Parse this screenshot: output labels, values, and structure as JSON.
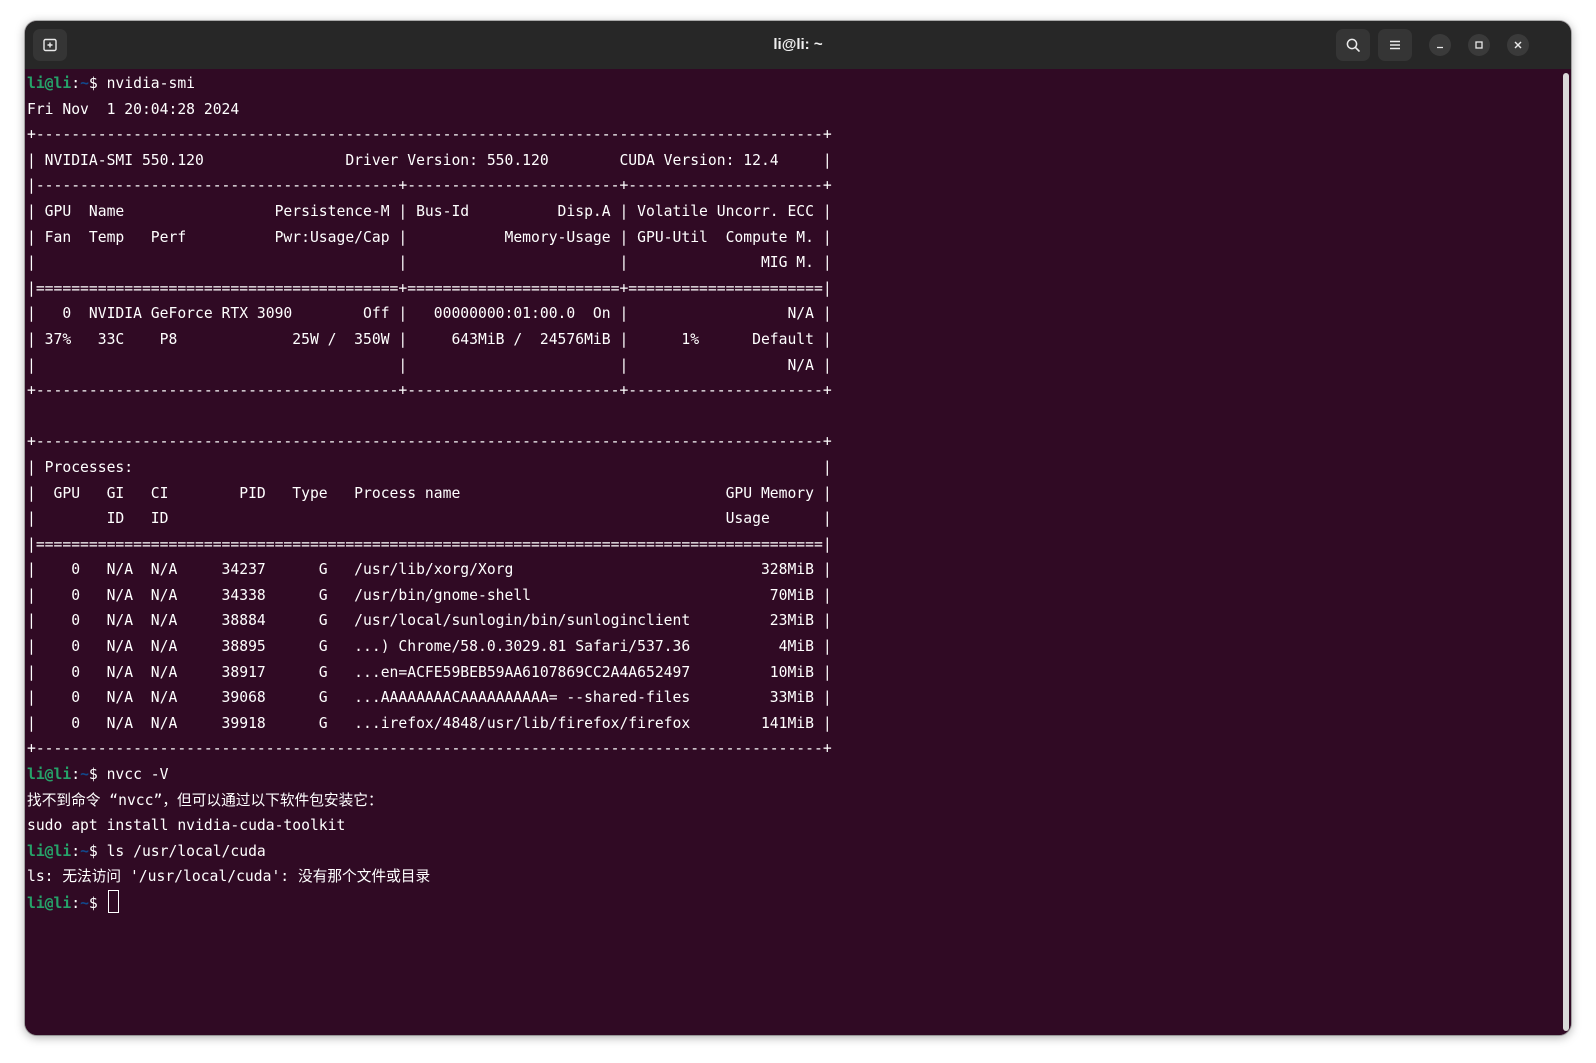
{
  "window": {
    "title": "li@li: ~"
  },
  "colors": {
    "terminal_bg": "#300a24",
    "titlebar_bg": "#272727",
    "prompt_user": "#26a269",
    "prompt_path": "#12488b",
    "text": "#ffffff"
  },
  "icons": {
    "new_tab": "new-tab-icon",
    "search": "search-icon",
    "menu": "hamburger-menu-icon",
    "minimize": "minimize-icon",
    "maximize": "maximize-icon",
    "close": "close-icon"
  },
  "terminal": {
    "prompt_user": "li@li",
    "prompt_sep": ":",
    "prompt_path": "~",
    "prompt_symbol": "$ ",
    "lines": [
      {
        "type": "prompt",
        "cmd": "nvidia-smi"
      },
      {
        "type": "out",
        "text": "Fri Nov  1 20:04:28 2024"
      },
      {
        "type": "out",
        "text": "+-----------------------------------------------------------------------------------------+"
      },
      {
        "type": "out",
        "text": "| NVIDIA-SMI 550.120                Driver Version: 550.120        CUDA Version: 12.4     |"
      },
      {
        "type": "out",
        "text": "|-----------------------------------------+------------------------+----------------------+"
      },
      {
        "type": "out",
        "text": "| GPU  Name                 Persistence-M | Bus-Id          Disp.A | Volatile Uncorr. ECC |"
      },
      {
        "type": "out",
        "text": "| Fan  Temp   Perf          Pwr:Usage/Cap |           Memory-Usage | GPU-Util  Compute M. |"
      },
      {
        "type": "out",
        "text": "|                                         |                        |               MIG M. |"
      },
      {
        "type": "out",
        "text": "|=========================================+========================+======================|"
      },
      {
        "type": "out",
        "text": "|   0  NVIDIA GeForce RTX 3090        Off |   00000000:01:00.0  On |                  N/A |"
      },
      {
        "type": "out",
        "text": "| 37%   33C    P8             25W /  350W |     643MiB /  24576MiB |      1%      Default |"
      },
      {
        "type": "out",
        "text": "|                                         |                        |                  N/A |"
      },
      {
        "type": "out",
        "text": "+-----------------------------------------+------------------------+----------------------+"
      },
      {
        "type": "out",
        "text": ""
      },
      {
        "type": "out",
        "text": "+-----------------------------------------------------------------------------------------+"
      },
      {
        "type": "out",
        "text": "| Processes:                                                                              |"
      },
      {
        "type": "out",
        "text": "|  GPU   GI   CI        PID   Type   Process name                              GPU Memory |"
      },
      {
        "type": "out",
        "text": "|        ID   ID                                                               Usage      |"
      },
      {
        "type": "out",
        "text": "|=========================================================================================|"
      },
      {
        "type": "out",
        "text": "|    0   N/A  N/A     34237      G   /usr/lib/xorg/Xorg                            328MiB |"
      },
      {
        "type": "out",
        "text": "|    0   N/A  N/A     34338      G   /usr/bin/gnome-shell                           70MiB |"
      },
      {
        "type": "out",
        "text": "|    0   N/A  N/A     38884      G   /usr/local/sunlogin/bin/sunloginclient         23MiB |"
      },
      {
        "type": "out",
        "text": "|    0   N/A  N/A     38895      G   ...) Chrome/58.0.3029.81 Safari/537.36          4MiB |"
      },
      {
        "type": "out",
        "text": "|    0   N/A  N/A     38917      G   ...en=ACFE59BEB59AA6107869CC2A4A652497         10MiB |"
      },
      {
        "type": "out",
        "text": "|    0   N/A  N/A     39068      G   ...AAAAAAAACAAAAAAAAAA= --shared-files         33MiB |"
      },
      {
        "type": "out",
        "text": "|    0   N/A  N/A     39918      G   ...irefox/4848/usr/lib/firefox/firefox        141MiB |"
      },
      {
        "type": "out",
        "text": "+-----------------------------------------------------------------------------------------+"
      },
      {
        "type": "prompt",
        "cmd": "nvcc -V"
      },
      {
        "type": "out",
        "text": "找不到命令 “nvcc”，但可以通过以下软件包安装它："
      },
      {
        "type": "out",
        "text": "sudo apt install nvidia-cuda-toolkit"
      },
      {
        "type": "prompt",
        "cmd": "ls /usr/local/cuda"
      },
      {
        "type": "out",
        "text": "ls: 无法访问 '/usr/local/cuda': 没有那个文件或目录"
      },
      {
        "type": "prompt",
        "cmd": "",
        "cursor": true
      }
    ]
  }
}
